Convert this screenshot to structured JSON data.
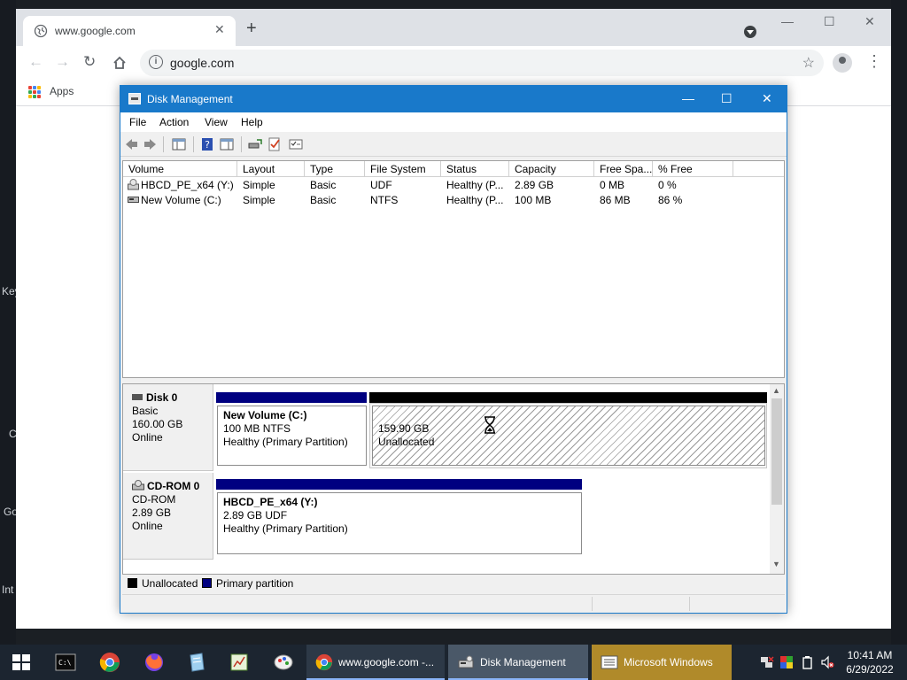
{
  "desktop": {
    "icon_labels": [
      "Key",
      "C",
      "Go",
      "Int"
    ]
  },
  "browser": {
    "tab_title": "www.google.com",
    "url": "google.com",
    "bookmarks_apps": "Apps"
  },
  "disk_mgmt": {
    "title": "Disk Management",
    "menu": [
      "File",
      "Action",
      "View",
      "Help"
    ],
    "columns": [
      "Volume",
      "Layout",
      "Type",
      "File System",
      "Status",
      "Capacity",
      "Free Spa...",
      "% Free"
    ],
    "volumes": [
      {
        "name": "HBCD_PE_x64 (Y:)",
        "layout": "Simple",
        "type": "Basic",
        "fs": "UDF",
        "status": "Healthy (P...",
        "capacity": "2.89 GB",
        "free": "0 MB",
        "pct": "0 %"
      },
      {
        "name": "New Volume (C:)",
        "layout": "Simple",
        "type": "Basic",
        "fs": "NTFS",
        "status": "Healthy (P...",
        "capacity": "100 MB",
        "free": "86 MB",
        "pct": "86 %"
      }
    ],
    "disks": [
      {
        "name": "Disk 0",
        "type": "Basic",
        "size": "160.00 GB",
        "state": "Online",
        "partitions": [
          {
            "name": "New Volume  (C:)",
            "size": "100 MB NTFS",
            "status": "Healthy (Primary Partition)"
          },
          {
            "size": "159.90 GB",
            "status": "Unallocated"
          }
        ]
      },
      {
        "name": "CD-ROM 0",
        "type": "CD-ROM",
        "size": "2.89 GB",
        "state": "Online",
        "partitions": [
          {
            "name": "HBCD_PE_x64  (Y:)",
            "size": "2.89 GB UDF",
            "status": "Healthy (Primary Partition)"
          }
        ]
      }
    ],
    "legend": [
      "Unallocated",
      "Primary partition"
    ],
    "colors": {
      "primary": "#000080",
      "unallocated": "#000000"
    }
  },
  "taskbar": {
    "items": [
      "www.google.com -...",
      "Disk Management",
      "Microsoft Windows"
    ],
    "time": "10:41 AM",
    "date": "6/29/2022"
  }
}
